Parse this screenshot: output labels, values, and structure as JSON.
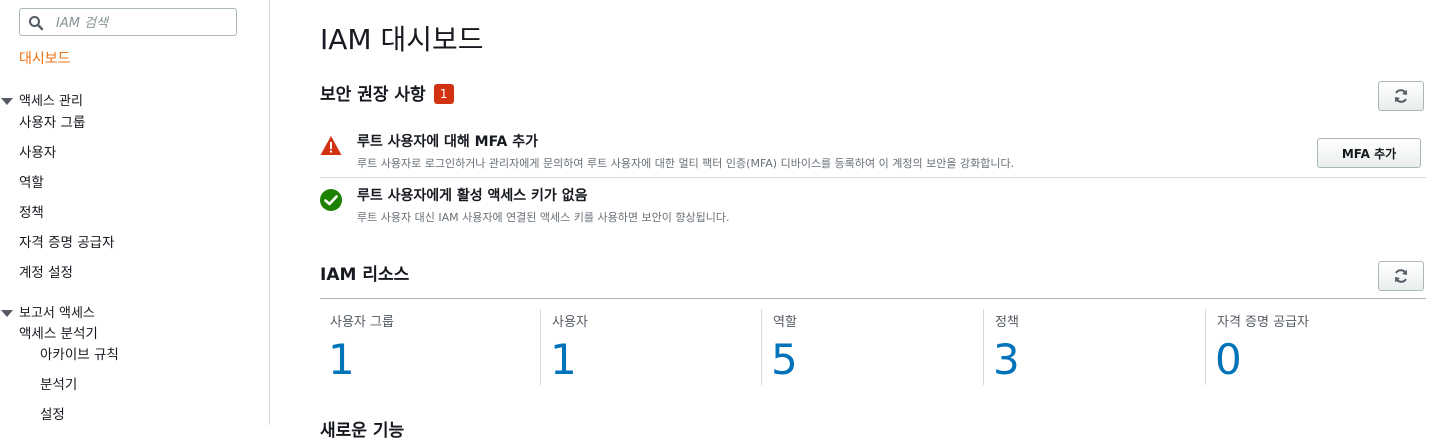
{
  "sidebar": {
    "search_placeholder": "IAM 검색",
    "dashboard": "대시보드",
    "access_management": {
      "title": "액세스 관리",
      "items": [
        "사용자 그룹",
        "사용자",
        "역할",
        "정책",
        "자격 증명 공급자",
        "계정 설정"
      ]
    },
    "report_access": {
      "title": "보고서 액세스",
      "analyzer": "액세스 분석기",
      "sub_items": [
        "아카이브 규칙",
        "분석기",
        "설정"
      ]
    }
  },
  "main": {
    "title": "IAM 대시보드",
    "security": {
      "title": "보안 권장 사항",
      "badge": "1",
      "recommendations": [
        {
          "status": "warning",
          "icon": "warning-icon",
          "title": "루트 사용자에 대해 MFA 추가",
          "description": "루트 사용자로 로그인하거나 관리자에게 문의하여 루트 사용자에 대한 멀티 팩터 인증(MFA) 디바이스를 등록하여 이 계정의 보안을 강화합니다.",
          "action_label": "MFA 추가"
        },
        {
          "status": "ok",
          "icon": "check-circle-icon",
          "title": "루트 사용자에게 활성 액세스 키가 없음",
          "description": "루트 사용자 대신 IAM 사용자에 연결된 액세스 키를 사용하면 보안이 향상됩니다."
        }
      ]
    },
    "resources": {
      "title": "IAM 리소스",
      "items": [
        {
          "label": "사용자 그룹",
          "count": "1"
        },
        {
          "label": "사용자",
          "count": "1"
        },
        {
          "label": "역할",
          "count": "5"
        },
        {
          "label": "정책",
          "count": "3"
        },
        {
          "label": "자격 증명 공급자",
          "count": "0"
        }
      ]
    },
    "next_section_title": "새로운 기능"
  },
  "colors": {
    "accent_orange": "#ec7211",
    "link_blue": "#0073bb",
    "badge_red": "#d13212",
    "warning_red": "#d13212",
    "success_green": "#1d8102"
  }
}
